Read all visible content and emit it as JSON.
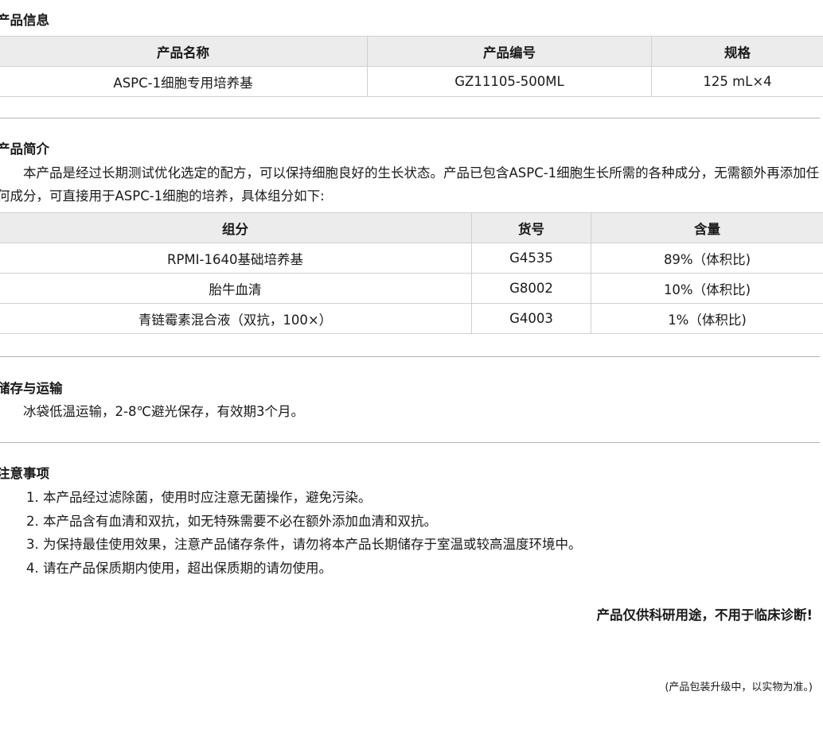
{
  "product_info": {
    "title": "产品信息",
    "headers": [
      "产品名称",
      "产品编号",
      "规格"
    ],
    "row": [
      "ASPC-1细胞专用培养基",
      "GZ11105-500ML",
      "125 mL×4"
    ]
  },
  "intro": {
    "title": "产品简介",
    "text": "　　本产品是经过长期测试优化选定的配方，可以保持细胞良好的生长状态。产品已包含ASPC-1细胞生长所需的各种成分，无需额外再添加任何成分，可直接用于ASPC-1细胞的培养，具体组分如下:",
    "headers": [
      "组分",
      "货号",
      "含量"
    ],
    "rows": [
      [
        "RPMI-1640基础培养基",
        "G4535",
        "89%（体积比)"
      ],
      [
        "胎牛血清",
        "G8002",
        "10%（体积比)"
      ],
      [
        "青链霉素混合液（双抗，100×）",
        "G4003",
        "1%（体积比)"
      ]
    ]
  },
  "storage": {
    "title": "储存与运输",
    "text": "　　冰袋低温运输，2-8℃避光保存，有效期3个月。"
  },
  "notes": {
    "title": "注意事项",
    "items": [
      "1. 本产品经过滤除菌，使用时应注意无菌操作，避免污染。",
      "2. 本产品含有血清和双抗，如无特殊需要不必在额外添加血清和双抗。",
      "3. 为保持最佳使用效果，注意产品储存条件，请勿将本产品长期储存于室温或较高温度环境中。",
      "4. 请在产品保质期内使用，超出保质期的请勿使用。"
    ]
  },
  "warning": "产品仅供科研用途，不用于临床诊断!",
  "footnote": "(产品包装升级中，以实物为准。)"
}
